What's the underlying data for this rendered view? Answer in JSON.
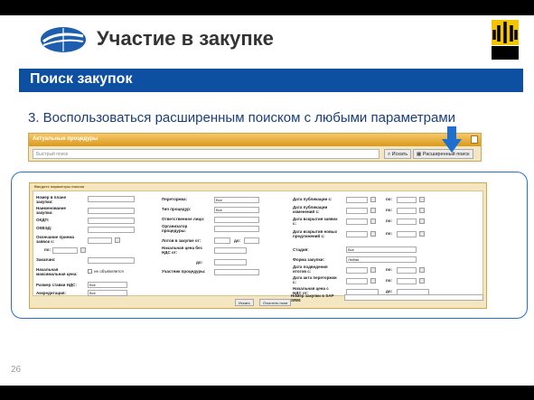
{
  "header": {
    "title": "Участие в закупке"
  },
  "section_bar": {
    "label": "Поиск закупок"
  },
  "instruction": "3. Воспользоваться расширенным поиском с любыми параметрами",
  "search": {
    "panel_title": "Актуальные процедуры",
    "placeholder": "Быстрый поиск",
    "search_button": "Искать",
    "advanced_button": "Расширенный поиск"
  },
  "advanced": {
    "title": "Введите параметры поиска",
    "col1": {
      "purchase_number": "Номер в плане закупки:",
      "purchase_name": "Наименование закупки:",
      "okdp": "ОКДП:",
      "okved": "ОКВЭД:",
      "deadline": "Окончание приема заявок с:",
      "deadline_to": "по:",
      "customer": "Заказчик:",
      "max_price": "Начальная максимальная цена:",
      "max_price_value": "не объявляется",
      "vat_rate": "Размер ставки НДС:",
      "vat_rate_value": "Все",
      "accreditation": "Аккредитация:",
      "accreditation_value": "Все"
    },
    "col2": {
      "rebidding": "Переторжка:",
      "rebidding_value": "Все",
      "procedure_type": "Тип процедур:",
      "procedure_type_value": "Все",
      "responsible": "Ответственное лицо:",
      "organizer": "Организатор процедуры:",
      "lots_from": "Лотов в закупке от:",
      "lots_to": "до:",
      "price_no_vat": "Начальная цена без НДС от:",
      "price_to": "до:",
      "participants": "Участник процедуры:"
    },
    "col3": {
      "pub_date": "Дата публикации с:",
      "pub_to": "по:",
      "change_date": "Дата публикации изменений с:",
      "change_to": "по:",
      "open_date": "Дата вскрытия заявок с:",
      "open_to": "по:",
      "new_offers_date": "Дата вскрытия новых предложений с:",
      "new_offers_to": "по:",
      "stage": "Стадия:",
      "stage_value": "Все",
      "purchase_form": "Форма закупки:",
      "purchase_form_value": "Любая",
      "summary_date": "Дата подведения итогов с:",
      "summary_to": "по:",
      "rebid_act_date": "Дата акта переторжки с:",
      "rebid_act_to": "по:",
      "init_price_vat": "Начальная цена с НДС от:",
      "init_price_to": "до:",
      "sap_number": "Номер закупки в SAP SRM:"
    },
    "buttons": {
      "search": "Искать",
      "clear": "Очистить поля"
    }
  },
  "page_number": "26",
  "colors": {
    "brand_blue": "#0d4fa0",
    "panel_bg": "#f3e6c0",
    "arrow": "#1f6fd0",
    "brand_yellow": "#f5c400"
  }
}
